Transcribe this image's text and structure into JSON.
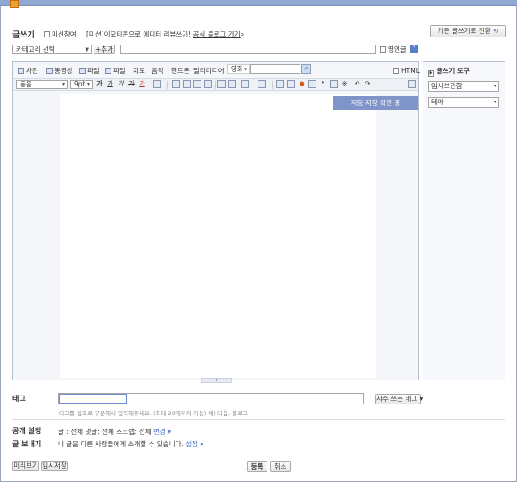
{
  "header": {
    "title": "글쓰기",
    "mission_checkbox_label": "미션참여",
    "mission_text": "[미션]이모티콘으로 에디터 리뷰쓰기!",
    "mission_link": "공식 블로그 가기",
    "mission_link_suffix": "»",
    "switch_button": "기존 글쓰기로 전환"
  },
  "category": {
    "selected": "카테고리 선택",
    "add_button": "+추가",
    "english_checkbox": "영인글",
    "help": "?"
  },
  "toolbar_insert": {
    "items": [
      "사진",
      "동영상",
      "파일",
      "파일",
      "지도",
      "음악",
      "핸드폰",
      "멀티미디어"
    ],
    "dropdown": "영화",
    "html_label": "HTML"
  },
  "toolbar_format": {
    "font": "돋움",
    "size": "9pt",
    "bold": "가",
    "underline": "가",
    "italic": "가",
    "strike": "가",
    "color": "가"
  },
  "editor": {
    "autosave": "자동 저장 확인 중"
  },
  "side_panel": {
    "title": "글쓰기 도구",
    "items": [
      "임시보관함",
      "테마"
    ]
  },
  "tags": {
    "label": "태그",
    "value": "",
    "frequent_button": "자주 쓰는 태그",
    "hint": "태그를 쉼표로 구분해서 입력해주세요. (최대 20개까지 가능) 예) 다음, 블로그"
  },
  "publish": {
    "label": "공개 설정",
    "text": "글 : 전체   댓글: 전체   스크랩: 전체",
    "change_link": "변경"
  },
  "share": {
    "label": "글 보내기",
    "text": "내 글을 다른 사람들에게 소개할 수 있습니다.",
    "settings_link": "설정"
  },
  "footer": {
    "preview": "미리보기",
    "temp_save": "임시저장",
    "submit": "등록",
    "cancel": "취소"
  },
  "colors": {
    "accent": "#8fa9d1",
    "autosave_bg": "#7f94c8",
    "link": "#4a74c6"
  }
}
